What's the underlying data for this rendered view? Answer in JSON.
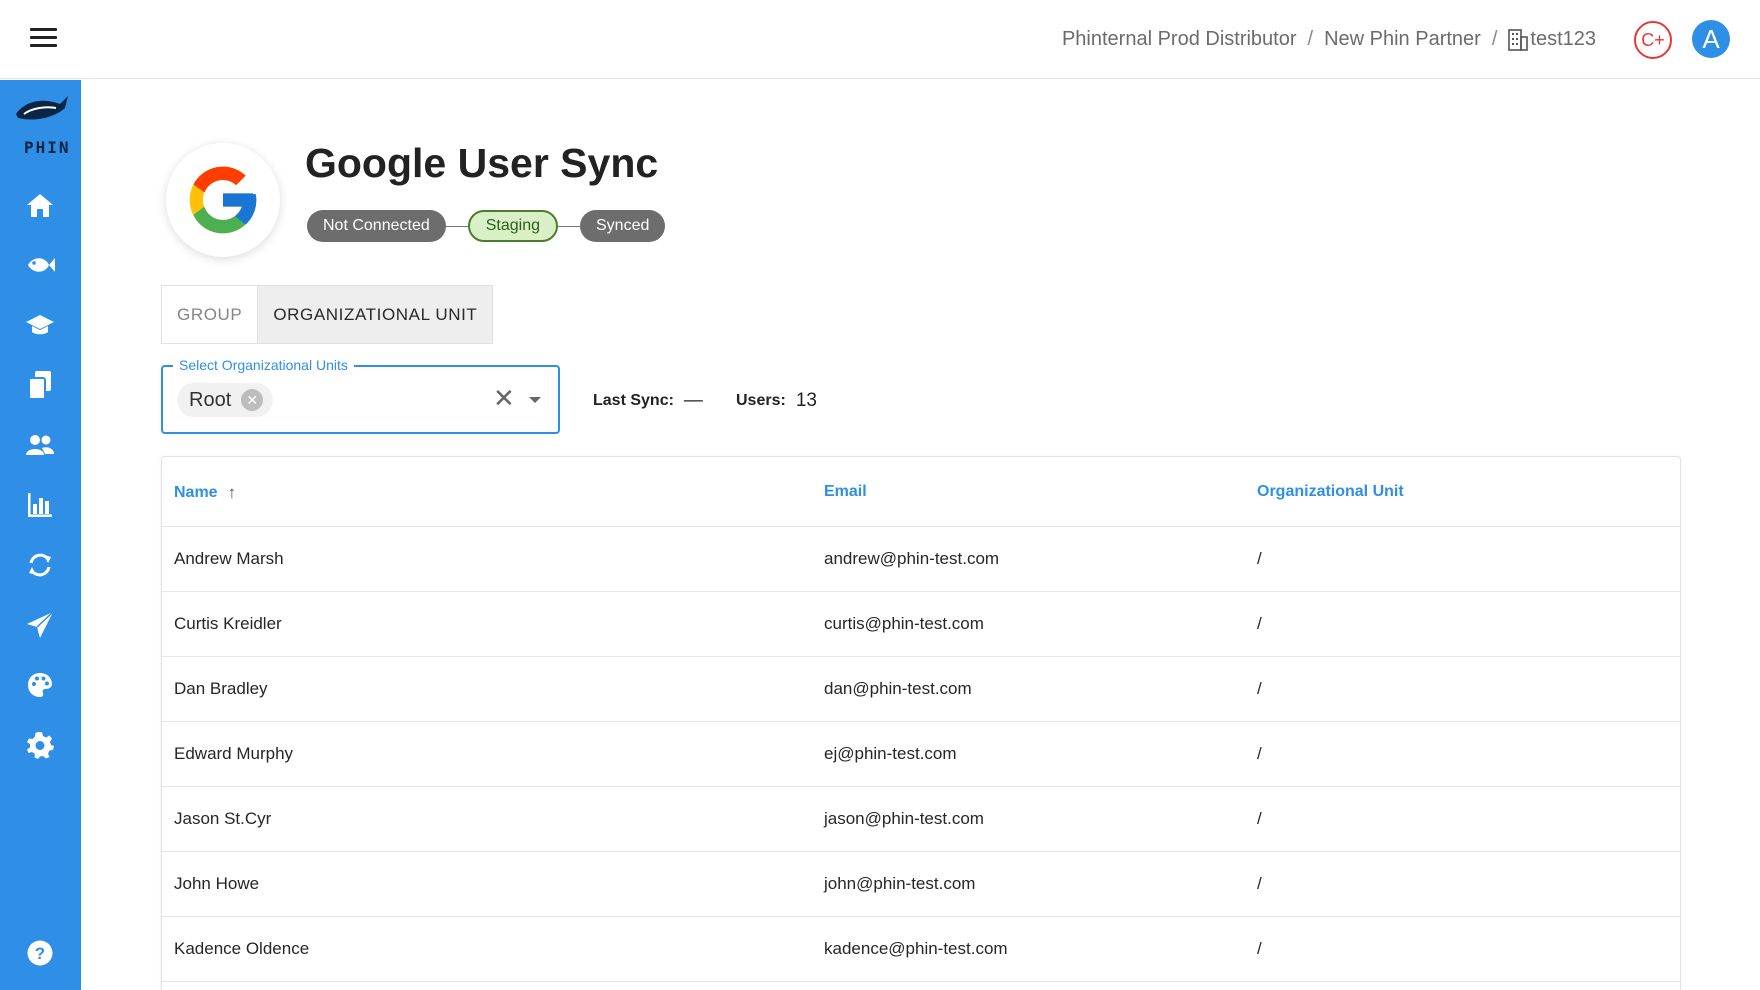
{
  "breadcrumb": {
    "items": [
      "Phinternal Prod Distributor",
      "New Phin Partner",
      "test123"
    ],
    "separator": "/"
  },
  "header_actions": {
    "cplus_label": "C+",
    "avatar_letter": "A"
  },
  "sidebar": {
    "logo_text": "PHIN",
    "items": [
      {
        "icon": "home-icon"
      },
      {
        "icon": "fish-icon"
      },
      {
        "icon": "graduation-cap-icon"
      },
      {
        "icon": "documents-icon"
      },
      {
        "icon": "users-icon"
      },
      {
        "icon": "bar-chart-icon"
      },
      {
        "icon": "sync-icon"
      },
      {
        "icon": "paper-plane-icon"
      },
      {
        "icon": "palette-icon"
      },
      {
        "icon": "gear-icon"
      },
      {
        "icon": "help-icon"
      }
    ],
    "color": "#2f8fe6"
  },
  "page": {
    "title": "Google User Sync",
    "steps": [
      "Not Connected",
      "Staging",
      "Synced"
    ],
    "active_step": "Staging"
  },
  "tabs": [
    "GROUP",
    "ORGANIZATIONAL UNIT"
  ],
  "active_tab": "ORGANIZATIONAL UNIT",
  "select": {
    "label": "Select Organizational Units",
    "selected_chip": "Root"
  },
  "meta": {
    "last_sync_label": "Last Sync:",
    "last_sync_value": "—",
    "users_label": "Users:",
    "users_value": "13"
  },
  "table": {
    "columns": [
      "Name",
      "Email",
      "Organizational Unit"
    ],
    "sort_column": "Name",
    "sort_direction": "ascending",
    "rows": [
      {
        "name": "Andrew Marsh",
        "email": "andrew@phin-test.com",
        "ou": "/"
      },
      {
        "name": "Curtis Kreidler",
        "email": "curtis@phin-test.com",
        "ou": "/"
      },
      {
        "name": "Dan Bradley",
        "email": "dan@phin-test.com",
        "ou": "/"
      },
      {
        "name": "Edward Murphy",
        "email": "ej@phin-test.com",
        "ou": "/"
      },
      {
        "name": "Jason St.Cyr",
        "email": "jason@phin-test.com",
        "ou": "/"
      },
      {
        "name": "John Howe",
        "email": "john@phin-test.com",
        "ou": "/"
      },
      {
        "name": "Kadence Oldence",
        "email": "kadence@phin-test.com",
        "ou": "/"
      }
    ]
  },
  "colors": {
    "accent": "#2f8fe6",
    "chip_grey": "#6d6d6d",
    "chip_active_bg": "#d9f0c6",
    "cplus_red": "#e53935"
  }
}
